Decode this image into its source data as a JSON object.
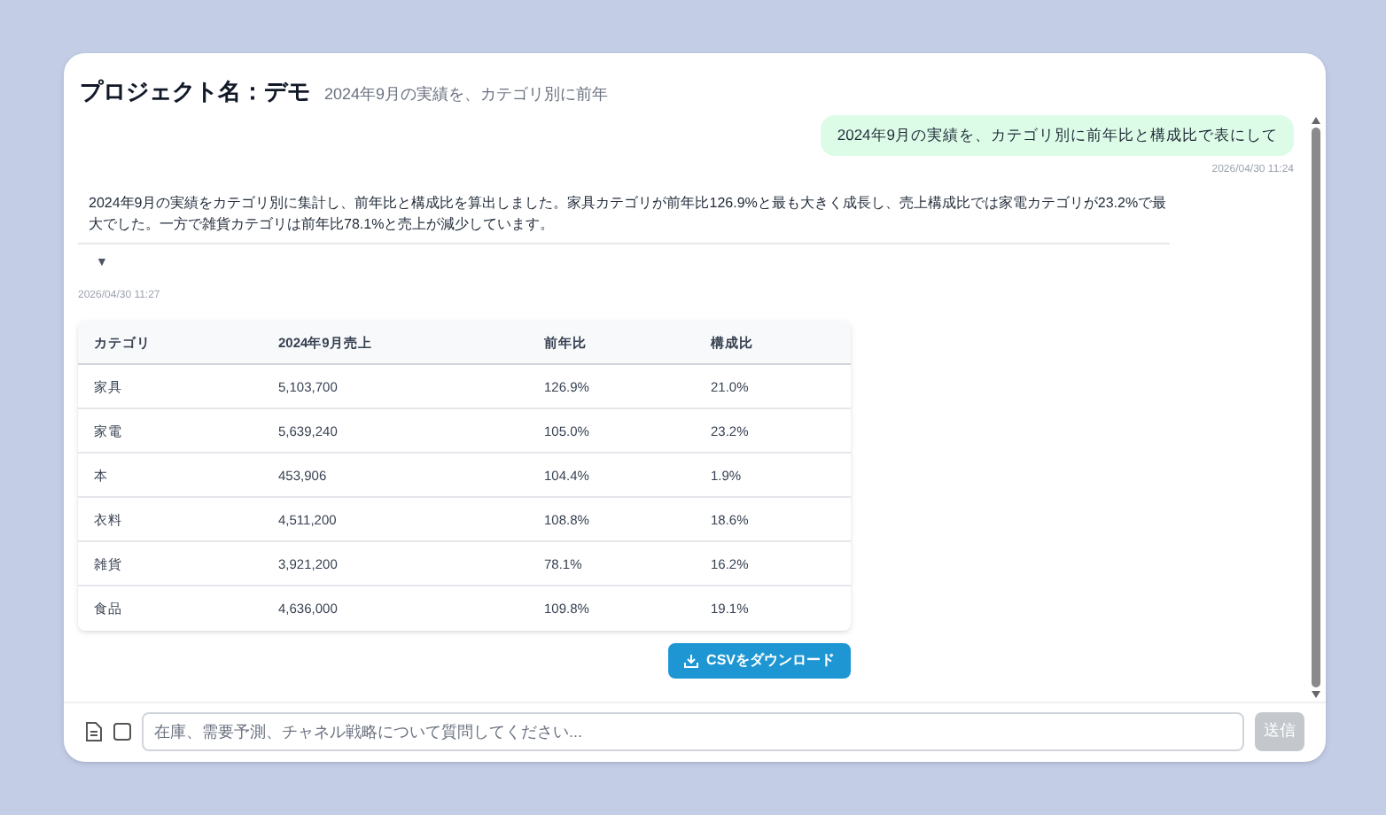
{
  "header": {
    "title": "プロジェクト名：デモ",
    "subtitle": "2024年9月の実績を、カテゴリ別に前年"
  },
  "messages": [
    {
      "kind": "user",
      "text": "2024年9月の実績を、カテゴリ別に前年比と構成比で表にして",
      "time": "2026/04/30 11:24"
    },
    {
      "kind": "assistant",
      "text": "2024年9月の実績をカテゴリ別に集計し、前年比と構成比を算出しました。家具カテゴリが前年比126.9%と最も大きく成長し、売上構成比では家電カテゴリが23.2%で最大でした。一方で雑貨カテゴリは前年比78.1%と売上が減少しています。",
      "toggle": "▼",
      "expanded": false,
      "time": "2026/04/30 11:27",
      "table": {
        "columns": [
          "カテゴリ",
          "2024年9月売上",
          "前年比",
          "構成比"
        ],
        "rows": [
          [
            "家具",
            "5,103,700",
            "126.9%",
            "21.0%"
          ],
          [
            "家電",
            "5,639,240",
            "105.0%",
            "23.2%"
          ],
          [
            "本",
            "453,906",
            "104.4%",
            "1.9%"
          ],
          [
            "衣料",
            "4,511,200",
            "108.8%",
            "18.6%"
          ],
          [
            "雑貨",
            "3,921,200",
            "78.1%",
            "16.2%"
          ],
          [
            "食品",
            "4,636,000",
            "109.8%",
            "19.1%"
          ]
        ]
      },
      "download_button": "CSVをダウンロード"
    }
  ],
  "composer": {
    "checked": false,
    "placeholder": "在庫、需要予測、チャネル戦略について質問してください...",
    "send": "送信",
    "send_disabled": true
  }
}
